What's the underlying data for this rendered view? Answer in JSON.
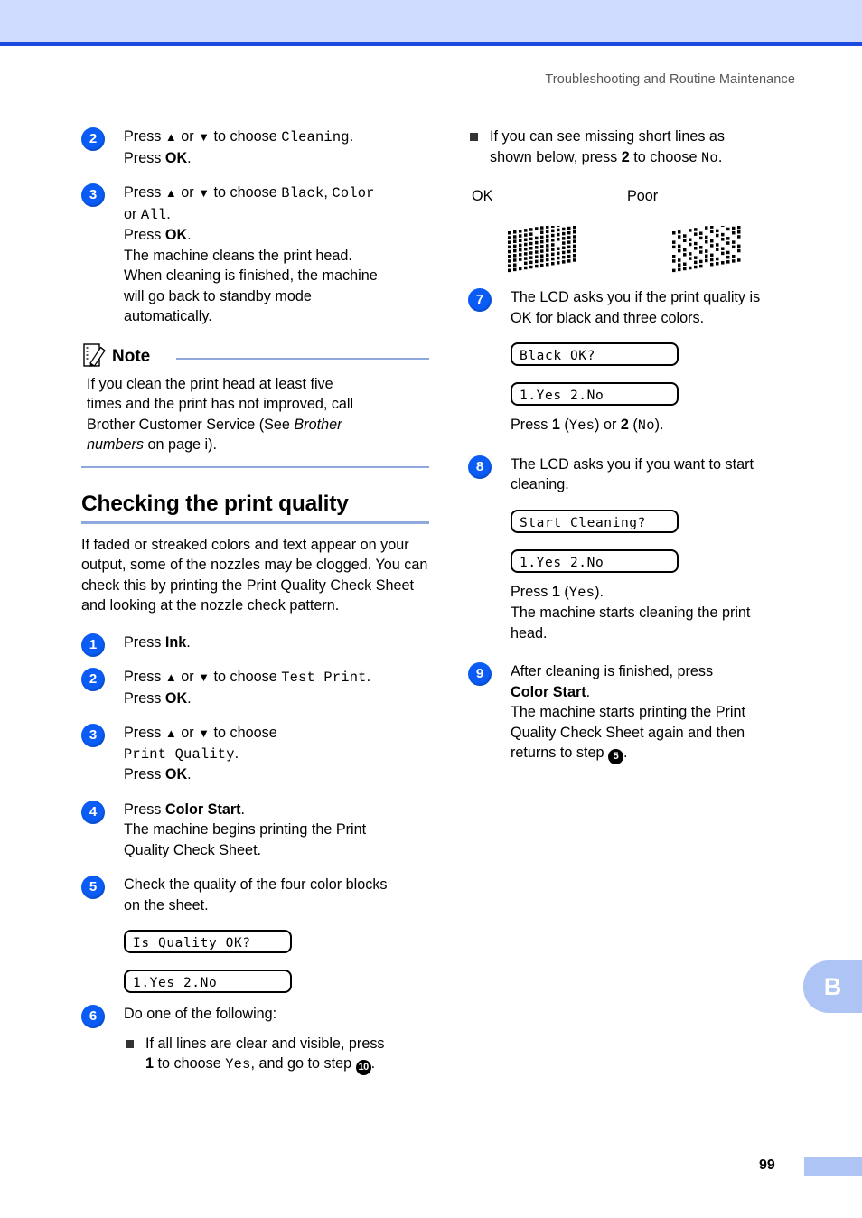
{
  "page": {
    "running_header": "Troubleshooting and Routine Maintenance",
    "folio": "99",
    "tab_label": "B",
    "accent_band": "#cfdcff",
    "accent_rule": "#1a4ae0",
    "step_circle_color": "#0a5cf5",
    "divider_color": "#8fa8dd"
  },
  "left_column": {
    "cleaning_steps": [
      {
        "num": "2",
        "lines": [
          {
            "parts": [
              {
                "t": "Press ",
                "s": "plain"
              },
              {
                "t": "▲",
                "s": "arrow"
              },
              {
                "t": " or ",
                "s": "plain"
              },
              {
                "t": "▼",
                "s": "arrow"
              },
              {
                "t": " to choose ",
                "s": "plain"
              },
              {
                "t": "Cleaning",
                "s": "mono"
              },
              {
                "t": ".",
                "s": "plain"
              }
            ]
          },
          {
            "parts": [
              {
                "t": "Press ",
                "s": "plain"
              },
              {
                "t": "OK",
                "s": "bold"
              },
              {
                "t": ".",
                "s": "plain"
              }
            ]
          }
        ]
      },
      {
        "num": "3",
        "lines": [
          {
            "parts": [
              {
                "t": "Press ",
                "s": "plain"
              },
              {
                "t": "▲",
                "s": "arrow"
              },
              {
                "t": " or ",
                "s": "plain"
              },
              {
                "t": "▼",
                "s": "arrow"
              },
              {
                "t": " to choose ",
                "s": "plain"
              },
              {
                "t": "Black",
                "s": "mono"
              },
              {
                "t": ", ",
                "s": "plain"
              },
              {
                "t": "Color",
                "s": "mono"
              }
            ]
          },
          {
            "parts": [
              {
                "t": "or ",
                "s": "plain"
              },
              {
                "t": "All",
                "s": "mono"
              },
              {
                "t": ".",
                "s": "plain"
              }
            ]
          },
          {
            "parts": [
              {
                "t": "Press ",
                "s": "plain"
              },
              {
                "t": "OK",
                "s": "bold"
              },
              {
                "t": ".",
                "s": "plain"
              }
            ]
          },
          {
            "parts": [
              {
                "t": "The machine cleans the print head.",
                "s": "plain"
              }
            ]
          },
          {
            "parts": [
              {
                "t": "When cleaning is finished, the machine",
                "s": "plain"
              }
            ]
          },
          {
            "parts": [
              {
                "t": "will go back to standby mode",
                "s": "plain"
              }
            ]
          },
          {
            "parts": [
              {
                "t": "automatically.",
                "s": "plain"
              }
            ]
          }
        ]
      }
    ],
    "note": {
      "title": "Note",
      "lines": [
        {
          "parts": [
            {
              "t": "If you clean the print head at least five",
              "s": "plain"
            }
          ]
        },
        {
          "parts": [
            {
              "t": "times and the print has not improved, call",
              "s": "plain"
            }
          ]
        },
        {
          "parts": [
            {
              "t": "Brother Customer Service (See ",
              "s": "plain"
            },
            {
              "t": "Brother",
              "s": "ital"
            }
          ]
        },
        {
          "parts": [
            {
              "t": "numbers",
              "s": "ital"
            },
            {
              "t": " on page i).",
              "s": "plain"
            }
          ]
        }
      ]
    },
    "section": {
      "title": "Checking the print quality",
      "intro": "If faded or streaked colors and text appear on your output, some of the nozzles may be clogged. You can check this by printing the Print Quality Check Sheet and looking at the nozzle check pattern."
    },
    "quality_steps": [
      {
        "num": "1",
        "lines": [
          {
            "parts": [
              {
                "t": "Press ",
                "s": "plain"
              },
              {
                "t": "Ink",
                "s": "bold"
              },
              {
                "t": ".",
                "s": "plain"
              }
            ]
          }
        ]
      },
      {
        "num": "2",
        "lines": [
          {
            "parts": [
              {
                "t": "Press ",
                "s": "plain"
              },
              {
                "t": "▲",
                "s": "arrow"
              },
              {
                "t": " or ",
                "s": "plain"
              },
              {
                "t": "▼",
                "s": "arrow"
              },
              {
                "t": " to choose ",
                "s": "plain"
              },
              {
                "t": "Test Print",
                "s": "mono"
              },
              {
                "t": ".",
                "s": "plain"
              }
            ]
          },
          {
            "parts": [
              {
                "t": "Press ",
                "s": "plain"
              },
              {
                "t": "OK",
                "s": "bold"
              },
              {
                "t": ".",
                "s": "plain"
              }
            ]
          }
        ]
      },
      {
        "num": "3",
        "lines": [
          {
            "parts": [
              {
                "t": "Press ",
                "s": "plain"
              },
              {
                "t": "▲",
                "s": "arrow"
              },
              {
                "t": " or ",
                "s": "plain"
              },
              {
                "t": "▼",
                "s": "arrow"
              },
              {
                "t": " to choose",
                "s": "plain"
              }
            ]
          },
          {
            "parts": [
              {
                "t": "Print Quality",
                "s": "mono"
              },
              {
                "t": ".",
                "s": "plain"
              }
            ]
          },
          {
            "parts": [
              {
                "t": "Press ",
                "s": "plain"
              },
              {
                "t": "OK",
                "s": "bold"
              },
              {
                "t": ".",
                "s": "plain"
              }
            ]
          }
        ]
      },
      {
        "num": "4",
        "lines": [
          {
            "parts": [
              {
                "t": "Press ",
                "s": "plain"
              },
              {
                "t": "Color Start",
                "s": "bold"
              },
              {
                "t": ".",
                "s": "plain"
              }
            ]
          },
          {
            "parts": [
              {
                "t": "The machine begins printing the Print",
                "s": "plain"
              }
            ]
          },
          {
            "parts": [
              {
                "t": "Quality Check Sheet.",
                "s": "plain"
              }
            ]
          }
        ]
      },
      {
        "num": "5",
        "lines": [
          {
            "parts": [
              {
                "t": "Check the quality of the four color blocks",
                "s": "plain"
              }
            ]
          },
          {
            "parts": [
              {
                "t": "on the sheet.",
                "s": "plain"
              }
            ]
          }
        ]
      }
    ],
    "lcd_quality": "Is Quality OK?",
    "lcd_yesno_1": "1.Yes 2.No",
    "step6": {
      "num": "6",
      "lines": [
        {
          "parts": [
            {
              "t": "Do one of the following:",
              "s": "plain"
            }
          ]
        }
      ],
      "bullet_lines": [
        {
          "parts": [
            {
              "t": "If all lines are clear and visible, press",
              "s": "plain"
            }
          ]
        },
        {
          "parts": [
            {
              "t": "1",
              "s": "bold"
            },
            {
              "t": " to choose ",
              "s": "plain"
            },
            {
              "t": "Yes",
              "s": "mono"
            },
            {
              "t": ", and go to step ",
              "s": "plain"
            },
            {
              "t": "10",
              "s": "circ"
            },
            {
              "t": ".",
              "s": "plain"
            }
          ]
        }
      ]
    }
  },
  "right_column": {
    "bullet_missing_lines": [
      {
        "parts": [
          {
            "t": "If you can see missing short lines as",
            "s": "plain"
          }
        ]
      },
      {
        "parts": [
          {
            "t": "shown below, press ",
            "s": "plain"
          },
          {
            "t": "2",
            "s": "bold"
          },
          {
            "t": " to choose ",
            "s": "plain"
          },
          {
            "t": "No",
            "s": "mono"
          },
          {
            "t": ".",
            "s": "plain"
          }
        ]
      }
    ],
    "specimen": {
      "label_ok": "OK",
      "label_poor": "Poor"
    },
    "step7": {
      "num": "7",
      "lines": [
        {
          "parts": [
            {
              "t": "The LCD asks you if the print quality is",
              "s": "plain"
            }
          ]
        },
        {
          "parts": [
            {
              "t": "OK for black and three colors.",
              "s": "plain"
            }
          ]
        }
      ],
      "lcd_1": "Black OK?",
      "lcd_2": "1.Yes 2.No",
      "after_lines": [
        {
          "parts": [
            {
              "t": "Press ",
              "s": "plain"
            },
            {
              "t": "1",
              "s": "bold"
            },
            {
              "t": " (",
              "s": "plain"
            },
            {
              "t": "Yes",
              "s": "mono"
            },
            {
              "t": ") or ",
              "s": "plain"
            },
            {
              "t": "2",
              "s": "bold"
            },
            {
              "t": " (",
              "s": "plain"
            },
            {
              "t": "No",
              "s": "mono"
            },
            {
              "t": ").",
              "s": "plain"
            }
          ]
        }
      ]
    },
    "step8": {
      "num": "8",
      "lines": [
        {
          "parts": [
            {
              "t": "The LCD asks you if you want to start",
              "s": "plain"
            }
          ]
        },
        {
          "parts": [
            {
              "t": "cleaning.",
              "s": "plain"
            }
          ]
        }
      ],
      "lcd_1": "Start Cleaning?",
      "lcd_2": "1.Yes 2.No",
      "after_lines": [
        {
          "parts": [
            {
              "t": "Press ",
              "s": "plain"
            },
            {
              "t": "1",
              "s": "bold"
            },
            {
              "t": " (",
              "s": "plain"
            },
            {
              "t": "Yes",
              "s": "mono"
            },
            {
              "t": ").",
              "s": "plain"
            }
          ]
        },
        {
          "parts": [
            {
              "t": "The machine starts cleaning the print",
              "s": "plain"
            }
          ]
        },
        {
          "parts": [
            {
              "t": "head.",
              "s": "plain"
            }
          ]
        }
      ]
    },
    "step9": {
      "num": "9",
      "lines": [
        {
          "parts": [
            {
              "t": "After cleaning is finished, press",
              "s": "plain"
            }
          ]
        },
        {
          "parts": [
            {
              "t": "Color Start",
              "s": "bold"
            },
            {
              "t": ".",
              "s": "plain"
            }
          ]
        },
        {
          "parts": [
            {
              "t": "The machine starts printing the Print",
              "s": "plain"
            }
          ]
        },
        {
          "parts": [
            {
              "t": "Quality Check Sheet again and then",
              "s": "plain"
            }
          ]
        },
        {
          "parts": [
            {
              "t": "returns to step ",
              "s": "plain"
            },
            {
              "t": "5",
              "s": "circ"
            },
            {
              "t": ".",
              "s": "plain"
            }
          ]
        }
      ]
    }
  }
}
